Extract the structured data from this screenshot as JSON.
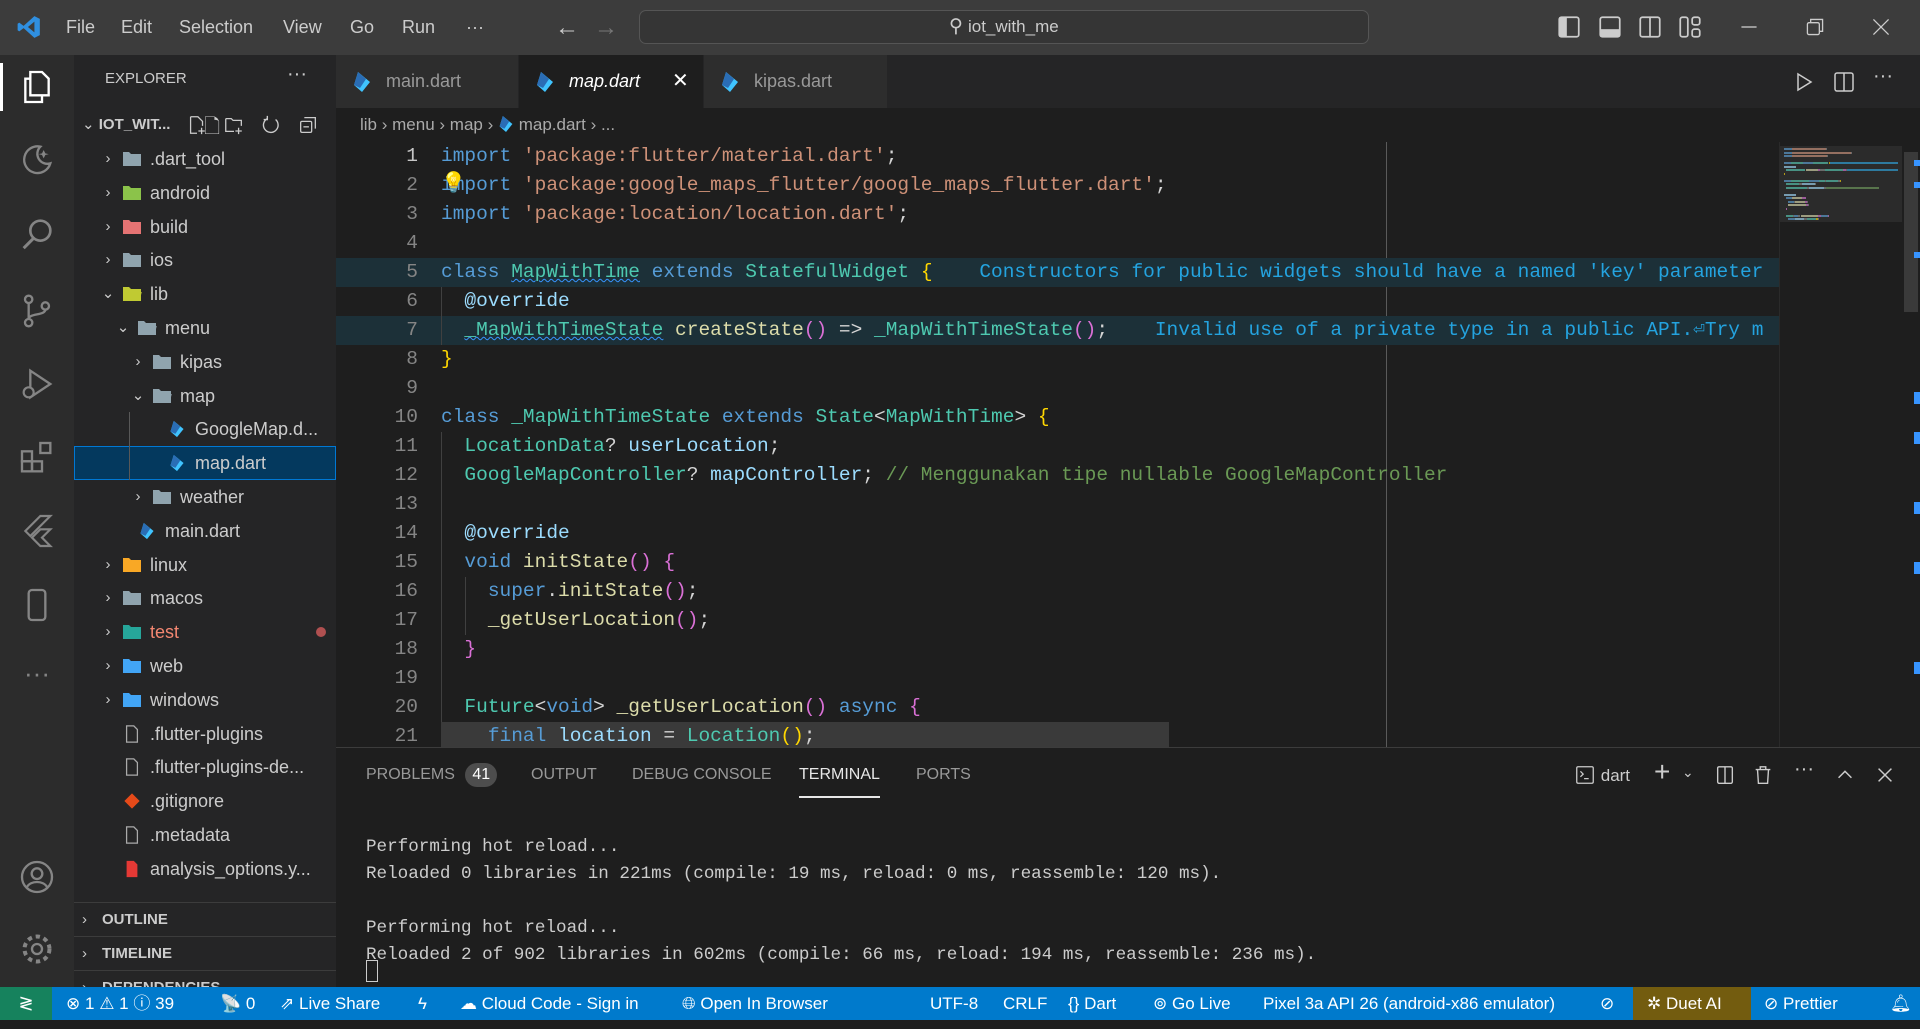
{
  "title_bar": {
    "menu": [
      "File",
      "Edit",
      "Selection",
      "View",
      "Go",
      "Run",
      "···"
    ],
    "search_text": "iot_with_me"
  },
  "sidebar": {
    "title": "EXPLORER",
    "more": "···",
    "root": "IOT_WIT...",
    "items": [
      {
        "label": ".dart_tool",
        "depth": 0,
        "type": "folder",
        "open": false,
        "color": "#90a4ae"
      },
      {
        "label": "android",
        "depth": 0,
        "type": "folder",
        "open": false,
        "color": "#8bc34a"
      },
      {
        "label": "build",
        "depth": 0,
        "type": "folder",
        "open": false,
        "color": "#e57373"
      },
      {
        "label": "ios",
        "depth": 0,
        "type": "folder",
        "open": false,
        "color": "#90a4ae"
      },
      {
        "label": "lib",
        "depth": 0,
        "type": "folder",
        "open": true,
        "color": "#c0ca33"
      },
      {
        "label": "menu",
        "depth": 1,
        "type": "folder",
        "open": true,
        "color": "#90a4ae"
      },
      {
        "label": "kipas",
        "depth": 2,
        "type": "folder",
        "open": false,
        "color": "#90a4ae"
      },
      {
        "label": "map",
        "depth": 2,
        "type": "folder",
        "open": true,
        "color": "#90a4ae"
      },
      {
        "label": "GoogleMap.d...",
        "depth": 3,
        "type": "dart"
      },
      {
        "label": "map.dart",
        "depth": 3,
        "type": "dart",
        "selected": true
      },
      {
        "label": "weather",
        "depth": 2,
        "type": "folder",
        "open": false,
        "color": "#90a4ae"
      },
      {
        "label": "main.dart",
        "depth": 1,
        "type": "dart"
      },
      {
        "label": "linux",
        "depth": 0,
        "type": "folder",
        "open": false,
        "color": "#f9a825"
      },
      {
        "label": "macos",
        "depth": 0,
        "type": "folder",
        "open": false,
        "color": "#90a4ae"
      },
      {
        "label": "test",
        "depth": 0,
        "type": "folder",
        "open": false,
        "color": "#26a69a",
        "error": true
      },
      {
        "label": "web",
        "depth": 0,
        "type": "folder",
        "open": false,
        "color": "#42a5f5"
      },
      {
        "label": "windows",
        "depth": 0,
        "type": "folder",
        "open": false,
        "color": "#42a5f5"
      },
      {
        "label": ".flutter-plugins",
        "depth": 0,
        "type": "file"
      },
      {
        "label": ".flutter-plugins-de...",
        "depth": 0,
        "type": "file"
      },
      {
        "label": ".gitignore",
        "depth": 0,
        "type": "git"
      },
      {
        "label": ".metadata",
        "depth": 0,
        "type": "file"
      },
      {
        "label": "analysis_options.y...",
        "depth": 0,
        "type": "yaml"
      }
    ],
    "sections": [
      "OUTLINE",
      "TIMELINE",
      "DEPENDENCIES"
    ]
  },
  "tabs": [
    {
      "label": "main.dart",
      "active": false
    },
    {
      "label": "map.dart",
      "active": true
    },
    {
      "label": "kipas.dart",
      "active": false
    }
  ],
  "breadcrumb": [
    "lib",
    "menu",
    "map",
    "map.dart",
    "..."
  ],
  "editor": {
    "current_line": 1,
    "lines": [
      [
        [
          "import ",
          "kw"
        ],
        [
          "'package:flutter/material.dart'",
          "str"
        ],
        [
          ";",
          "pl"
        ]
      ],
      [
        [
          "import ",
          "kw"
        ],
        [
          "'package:google_maps_flutter/google_maps_flutter.dart'",
          "str"
        ],
        [
          ";",
          "pl"
        ]
      ],
      [
        [
          "import ",
          "kw"
        ],
        [
          "'package:location/location.dart'",
          "str"
        ],
        [
          ";",
          "pl"
        ]
      ],
      [],
      [
        [
          "class ",
          "kw"
        ],
        [
          "MapWithTime",
          "ty sq"
        ],
        [
          " extends ",
          "kw"
        ],
        [
          "StatefulWidget",
          "ty"
        ],
        [
          " ",
          "pl"
        ],
        [
          "{",
          "br1"
        ],
        [
          "    Constructors for public widgets should have a named 'key' parameter",
          "diag"
        ]
      ],
      [
        [
          "  @override",
          "var"
        ]
      ],
      [
        [
          "  ",
          "pl"
        ],
        [
          "_MapWithTimeState",
          "ty sq"
        ],
        [
          " ",
          "pl"
        ],
        [
          "createState",
          "fn"
        ],
        [
          "()",
          "br2"
        ],
        [
          " => ",
          "pl"
        ],
        [
          "_MapWithTimeState",
          "ty"
        ],
        [
          "()",
          "br2"
        ],
        [
          ";",
          "pl"
        ],
        [
          "    Invalid use of a private type in a public API.⏎Try m",
          "diag"
        ]
      ],
      [
        [
          "}",
          "br1"
        ]
      ],
      [],
      [
        [
          "class ",
          "kw"
        ],
        [
          "_MapWithTimeState",
          "ty"
        ],
        [
          " extends ",
          "kw"
        ],
        [
          "State",
          "ty"
        ],
        [
          "<",
          "pl"
        ],
        [
          "MapWithTime",
          "ty"
        ],
        [
          "> ",
          "pl"
        ],
        [
          "{",
          "br1"
        ]
      ],
      [
        [
          "  ",
          "pl"
        ],
        [
          "LocationData",
          "ty"
        ],
        [
          "? ",
          "pl"
        ],
        [
          "userLocation",
          "var"
        ],
        [
          ";",
          "pl"
        ]
      ],
      [
        [
          "  ",
          "pl"
        ],
        [
          "GoogleMapController",
          "ty"
        ],
        [
          "? ",
          "pl"
        ],
        [
          "mapController",
          "var"
        ],
        [
          "; ",
          "pl"
        ],
        [
          "// Menggunakan tipe nullable GoogleMapController",
          "cm"
        ]
      ],
      [],
      [
        [
          "  @override",
          "var"
        ]
      ],
      [
        [
          "  ",
          "pl"
        ],
        [
          "void ",
          "kw"
        ],
        [
          "initState",
          "fn"
        ],
        [
          "() ",
          "br2"
        ],
        [
          "{",
          "br2"
        ]
      ],
      [
        [
          "    ",
          "pl"
        ],
        [
          "super",
          "kw"
        ],
        [
          ".",
          "pl"
        ],
        [
          "initState",
          "fn"
        ],
        [
          "()",
          "br2"
        ],
        [
          ";",
          "pl"
        ]
      ],
      [
        [
          "    ",
          "pl"
        ],
        [
          "_getUserLocation",
          "fn"
        ],
        [
          "()",
          "br2"
        ],
        [
          ";",
          "pl"
        ]
      ],
      [
        [
          "  ",
          "pl"
        ],
        [
          "}",
          "br2"
        ]
      ],
      [],
      [
        [
          "  ",
          "pl"
        ],
        [
          "Future",
          "ty"
        ],
        [
          "<",
          "pl"
        ],
        [
          "void",
          "kw"
        ],
        [
          "> ",
          "pl"
        ],
        [
          "_getUserLocation",
          "fn"
        ],
        [
          "() ",
          "br2"
        ],
        [
          "async ",
          "kw"
        ],
        [
          "{",
          "br2"
        ]
      ],
      [
        [
          "    ",
          "pl"
        ],
        [
          "final ",
          "kw"
        ],
        [
          "location",
          "var"
        ],
        [
          " = ",
          "pl"
        ],
        [
          "Location",
          "ty"
        ],
        [
          "()",
          "br1"
        ],
        [
          ";",
          "pl"
        ]
      ]
    ]
  },
  "panel": {
    "tabs": [
      "PROBLEMS",
      "OUTPUT",
      "DEBUG CONSOLE",
      "TERMINAL",
      "PORTS"
    ],
    "problems_count": "41",
    "active_tab": "TERMINAL",
    "terminal_name": "dart",
    "terminal_lines": [
      "Performing hot reload...",
      "Reloaded 0 libraries in 221ms (compile: 19 ms, reload: 0 ms, reassemble: 120 ms).",
      "",
      "Performing hot reload...",
      "Reloaded 2 of 902 libraries in 602ms (compile: 66 ms, reload: 194 ms, reassemble: 236 ms)."
    ]
  },
  "status_bar": {
    "errors": "1",
    "warnings": "1",
    "infos": "39",
    "ports": "0",
    "live_share": "Live Share",
    "cloud_code": "Cloud Code - Sign in",
    "open_browser": "Open In Browser",
    "encoding": "UTF-8",
    "eol": "CRLF",
    "language": "Dart",
    "go_live": "Go Live",
    "device": "Pixel 3a API 26 (android-x86 emulator)",
    "duet": "Duet AI",
    "prettier": "Prettier",
    "colors": {
      "bg": "#007acc",
      "remote": "#16825d",
      "duet": "#735c0f"
    }
  }
}
